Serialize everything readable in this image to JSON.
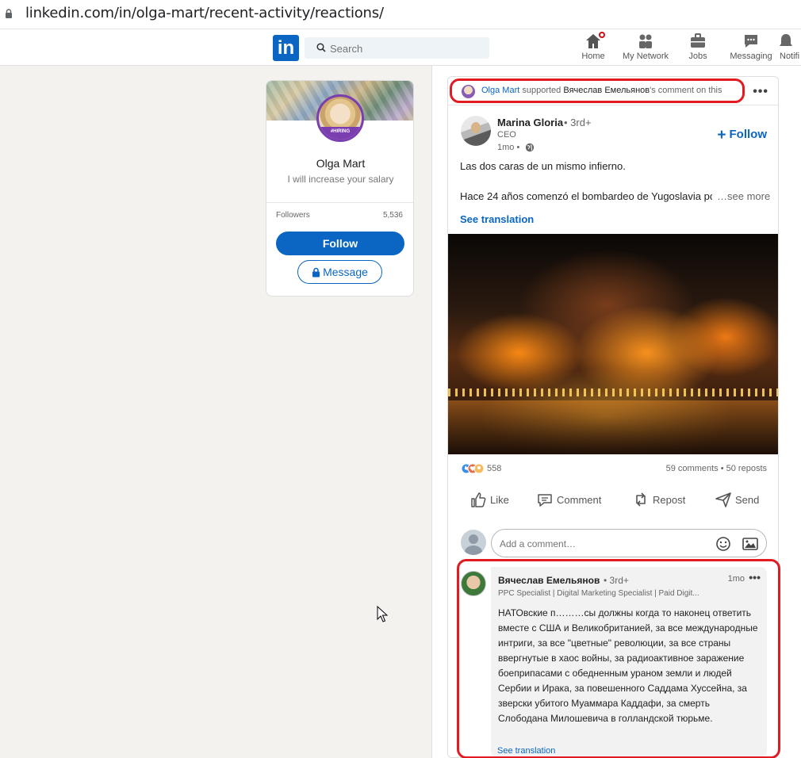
{
  "browser": {
    "url": "linkedin.com/in/olga-mart/recent-activity/reactions/"
  },
  "header": {
    "search_placeholder": "Search",
    "nav": [
      {
        "label": "Home"
      },
      {
        "label": "My Network"
      },
      {
        "label": "Jobs"
      },
      {
        "label": "Messaging"
      },
      {
        "label": "Notifi"
      }
    ]
  },
  "profile": {
    "name": "Olga Mart",
    "headline": "I will increase your salary",
    "followers_label": "Followers",
    "followers_count": "5,536",
    "follow_button": "Follow",
    "message_button": "Message",
    "avatar_badge": "#HIRING"
  },
  "post": {
    "activity": {
      "actor": "Olga Mart",
      "verb": "supported",
      "target": "Вячеслав Емельянов",
      "suffix": "'s comment on this"
    },
    "author": {
      "name": "Marina Gloria",
      "degree": "• 3rd+",
      "title": "CEO",
      "time": "1mo •"
    },
    "follow_label": "Follow",
    "text_line1": "Las dos caras de un mismo infierno.",
    "text_line2": "Hace 24 años comenzó el bombardeo de Yugoslavia po",
    "see_more": "…see more",
    "see_translation": "See translation",
    "reactions_count": "558",
    "stats": "59 comments • 50 reposts",
    "actions": [
      "Like",
      "Comment",
      "Repost",
      "Send"
    ],
    "comment_placeholder": "Add a comment…",
    "comment": {
      "name": "Вячеслав Емельянов",
      "degree": "• 3rd+",
      "time": "1mo",
      "headline": "PPC Specialist | Digital Marketing Specialist | Paid Digit...",
      "body": "НАТОвские п………сы должны когда то наконец ответить вместе с США и Великобританией, за все международные интриги, за все \"цветные\" революции, за все страны ввергнутые в хаос войны, за радиоактивное заражение боеприпасами с обедненным ураном земли и людей Сербии и Ирака, за повешенного Саддама Хуссейна, за зверски убитого Муаммара Каддафи, за смерть Слободана Милошевича в голландской тюрьме.",
      "see_translation": "See translation"
    }
  },
  "colors": {
    "brand": "#0a66c2",
    "highlight": "#e21b22"
  }
}
